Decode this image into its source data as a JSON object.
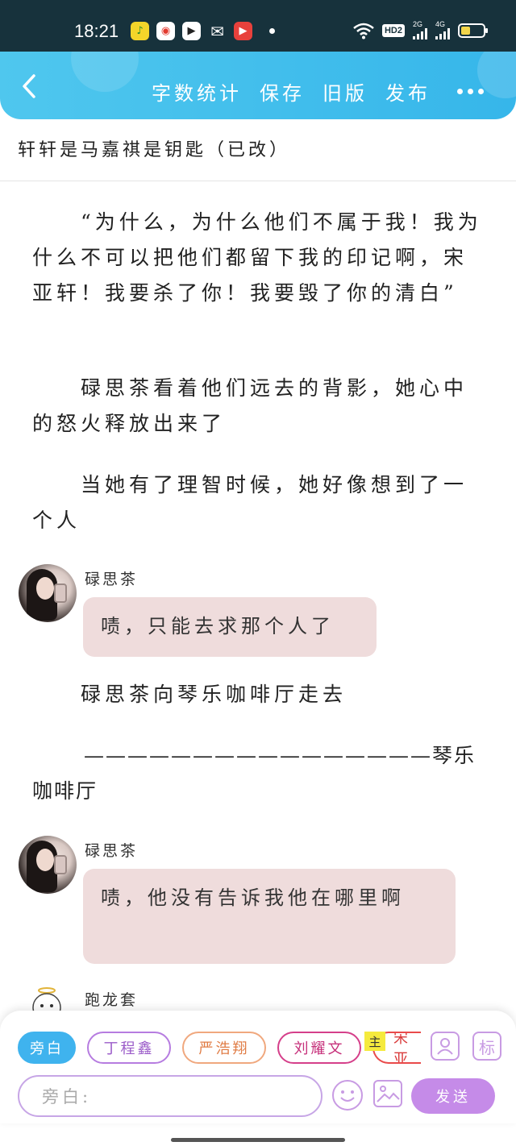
{
  "status_bar": {
    "time": "18:21",
    "notification_icons": [
      "qq-music-icon",
      "weibo-icon",
      "bilibili-icon",
      "wechat-icon",
      "video-icon"
    ],
    "network_type_1": "2G",
    "network_type_2": "4G",
    "hd_label": "HD2",
    "battery_percent": 25
  },
  "header": {
    "actions": [
      "字数统计",
      "保存",
      "旧版",
      "发布"
    ],
    "colors": {
      "start": "#4fc7ee",
      "end": "#36b6ea"
    }
  },
  "document": {
    "title": "轩轩是马嘉祺是钥匙（已改）",
    "paragraphs": [
      "“为什么，为什么他们不属于我！我为什么不可以把他们都留下我的印记啊，宋亚轩！我要杀了你！我要毁了你的清白”",
      "碌思茶看着他们远去的背影，她心中的怒火释放出来了",
      "当她有了理智时候，她好像想到了一个人",
      "碌思茶向琴乐咖啡厅走去",
      "————————————————琴乐咖啡厅"
    ],
    "messages": [
      {
        "speaker": "碌思茶",
        "text": "啧，只能去求那个人了"
      },
      {
        "speaker": "碌思茶",
        "text": "啧，他没有告诉我他在哪里啊"
      }
    ],
    "last_speaker": "跑龙套"
  },
  "toolbar": {
    "roles": [
      "旁白",
      "丁程鑫",
      "严浩翔",
      "刘耀文",
      "宋亚"
    ],
    "main_tag": "主",
    "mark_button_label": "标",
    "input_placeholder": "旁白:",
    "send_label": "发送",
    "colors": {
      "active": "#3fb3ee",
      "send": "#c58be8",
      "bubble": "#efdcdc"
    }
  }
}
